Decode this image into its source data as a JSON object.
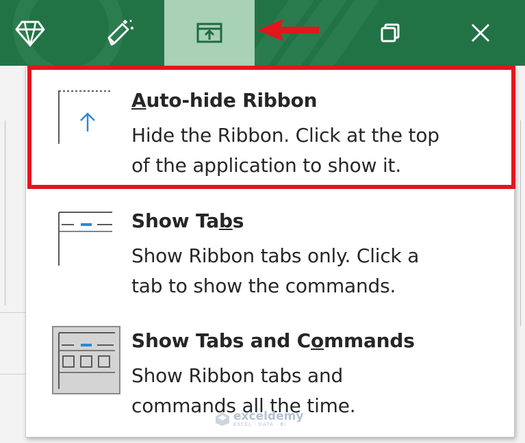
{
  "titlebar": {
    "buttons": [
      {
        "name": "Premium",
        "icon": "diamond-icon"
      },
      {
        "name": "Coauthoring",
        "icon": "pen-sparkle-icon"
      },
      {
        "name": "Ribbon Display Options",
        "icon": "ribbon-display-options-icon",
        "active": true
      },
      {
        "name": "Restore Down",
        "icon": "restore-icon"
      },
      {
        "name": "Close",
        "icon": "close-icon"
      }
    ],
    "colors": {
      "background": "#217346",
      "active": "#a9d1b4",
      "arrow": "#e3151d"
    }
  },
  "menu": {
    "items": [
      {
        "title_prefix": "",
        "title_accel": "A",
        "title_suffix": "uto-hide Ribbon",
        "desc_line1": "Hide the Ribbon. Click at the top",
        "desc_line2": "of the application to show it.",
        "icon": "auto-hide-ribbon-icon",
        "highlighted": true
      },
      {
        "title_prefix": "Show Ta",
        "title_accel": "b",
        "title_suffix": "s",
        "desc_line1": "Show Ribbon tabs only. Click a",
        "desc_line2": "tab to show the commands.",
        "icon": "show-tabs-icon",
        "highlighted": false
      },
      {
        "title_prefix": "Show Tabs and C",
        "title_accel": "o",
        "title_suffix": "mmands",
        "desc_line1": "Show Ribbon tabs and",
        "desc_line2": "commands all the time.",
        "icon": "show-tabs-and-commands-icon",
        "selected": true
      }
    ]
  },
  "watermark": {
    "name": "exceldemy",
    "tagline": "EXCEL · DATA · BI"
  }
}
